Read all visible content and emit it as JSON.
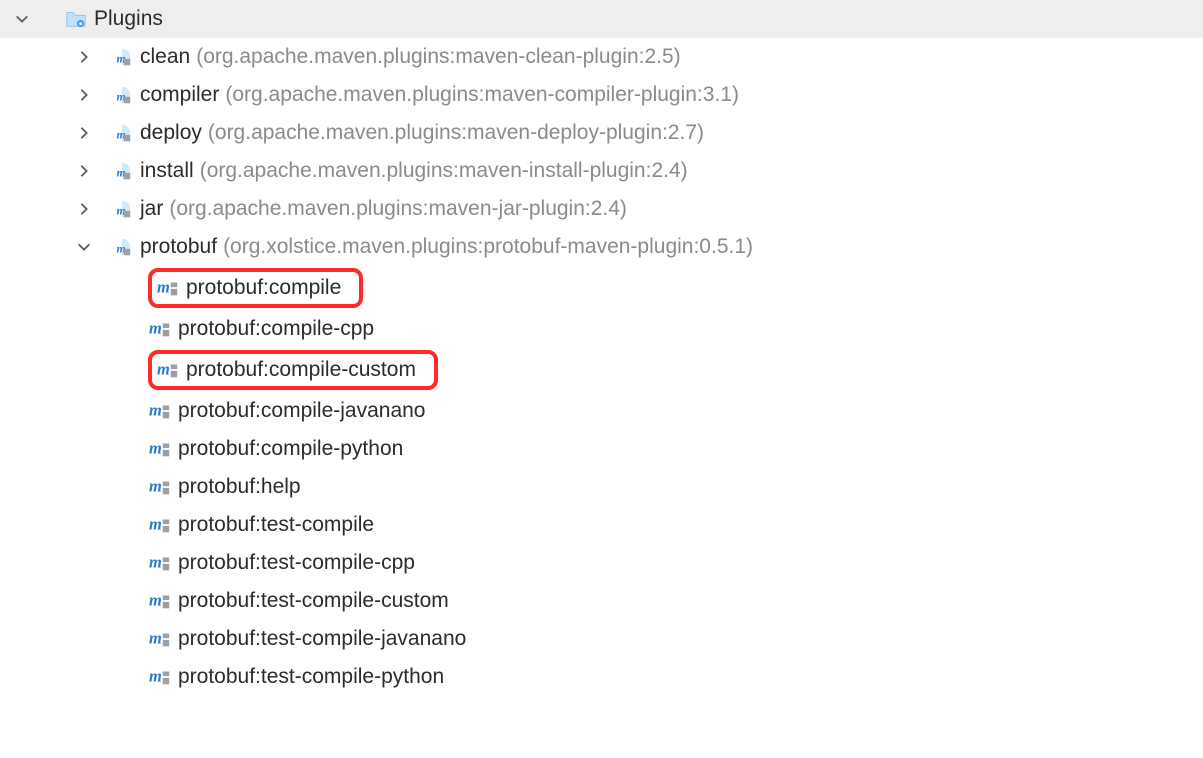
{
  "root": {
    "label": "Plugins"
  },
  "plugins": [
    {
      "name": "clean",
      "coord": "(org.apache.maven.plugins:maven-clean-plugin:2.5)",
      "expanded": false,
      "goals": []
    },
    {
      "name": "compiler",
      "coord": "(org.apache.maven.plugins:maven-compiler-plugin:3.1)",
      "expanded": false,
      "goals": []
    },
    {
      "name": "deploy",
      "coord": "(org.apache.maven.plugins:maven-deploy-plugin:2.7)",
      "expanded": false,
      "goals": []
    },
    {
      "name": "install",
      "coord": "(org.apache.maven.plugins:maven-install-plugin:2.4)",
      "expanded": false,
      "goals": []
    },
    {
      "name": "jar",
      "coord": "(org.apache.maven.plugins:maven-jar-plugin:2.4)",
      "expanded": false,
      "goals": []
    },
    {
      "name": "protobuf",
      "coord": "(org.xolstice.maven.plugins:protobuf-maven-plugin:0.5.1)",
      "expanded": true,
      "goals": [
        {
          "label": "protobuf:compile",
          "highlight": true
        },
        {
          "label": "protobuf:compile-cpp",
          "highlight": false
        },
        {
          "label": "protobuf:compile-custom",
          "highlight": true
        },
        {
          "label": "protobuf:compile-javanano",
          "highlight": false
        },
        {
          "label": "protobuf:compile-python",
          "highlight": false
        },
        {
          "label": "protobuf:help",
          "highlight": false
        },
        {
          "label": "protobuf:test-compile",
          "highlight": false
        },
        {
          "label": "protobuf:test-compile-cpp",
          "highlight": false
        },
        {
          "label": "protobuf:test-compile-custom",
          "highlight": false
        },
        {
          "label": "protobuf:test-compile-javanano",
          "highlight": false
        },
        {
          "label": "protobuf:test-compile-python",
          "highlight": false
        }
      ]
    }
  ]
}
